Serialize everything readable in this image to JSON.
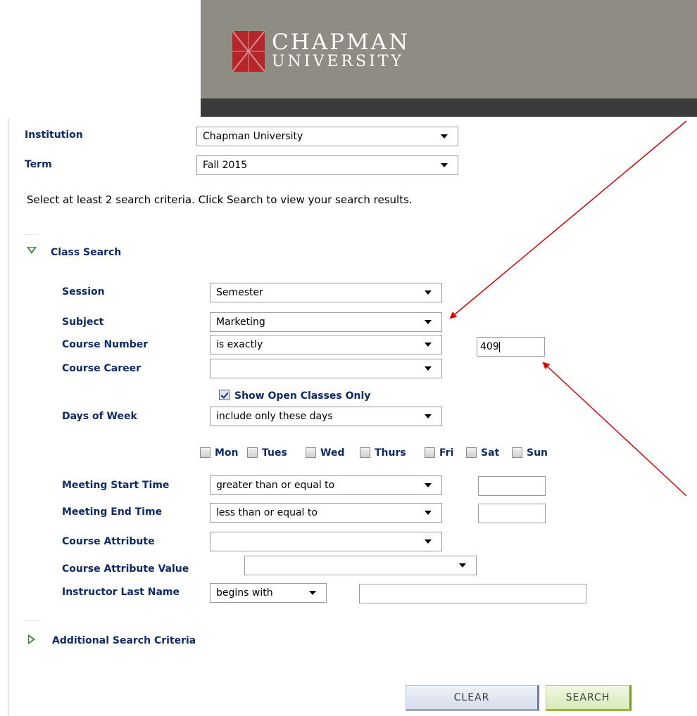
{
  "header": {
    "logo_line1": "CHAPMAN",
    "logo_line2": "UNIVERSITY",
    "colors": {
      "banner": "#8f8c83",
      "strip": "#3b3b3b",
      "logo_red": "#b5262b"
    }
  },
  "institution": {
    "label": "Institution",
    "value": "Chapman University"
  },
  "term": {
    "label": "Term",
    "value": "Fall 2015"
  },
  "instructions": "Select at least 2 search criteria. Click Search to view your search results.",
  "class_search": {
    "title": "Class Search",
    "session": {
      "label": "Session",
      "value": "Semester"
    },
    "subject": {
      "label": "Subject",
      "value": "Marketing"
    },
    "course_number": {
      "label": "Course Number",
      "operator": "is exactly",
      "value": "409"
    },
    "course_career": {
      "label": "Course Career",
      "value": ""
    },
    "open_only": {
      "label": "Show Open Classes Only",
      "checked": true
    },
    "days_of_week": {
      "label": "Days of Week",
      "operator": "include only these days"
    },
    "days": [
      "Mon",
      "Tues",
      "Wed",
      "Thurs",
      "Fri",
      "Sat",
      "Sun"
    ],
    "start_time": {
      "label": "Meeting Start Time",
      "operator": "greater than or equal to",
      "value": ""
    },
    "end_time": {
      "label": "Meeting End Time",
      "operator": "less than or equal to",
      "value": ""
    },
    "course_attribute": {
      "label": "Course Attribute",
      "value": ""
    },
    "course_attribute_value": {
      "label": "Course Attribute Value",
      "value": ""
    },
    "instructor": {
      "label": "Instructor Last Name",
      "operator": "begins with",
      "value": ""
    }
  },
  "additional": {
    "title": "Additional Search Criteria"
  },
  "buttons": {
    "clear": "CLEAR",
    "search": "SEARCH"
  },
  "annotations": {
    "arrow_color": "#e00000"
  }
}
